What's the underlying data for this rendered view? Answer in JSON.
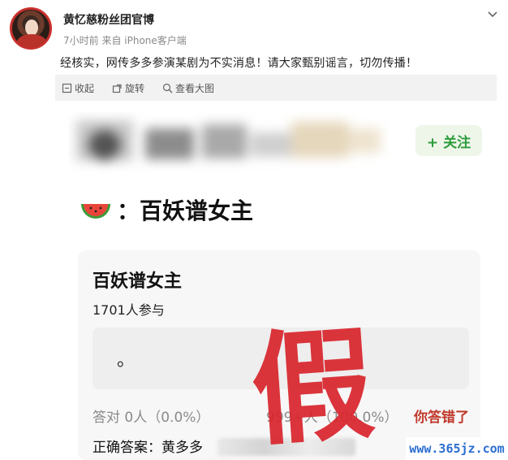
{
  "post": {
    "username": "黄忆慈粉丝团官博",
    "meta": "7小时前  来自 iPhone客户端",
    "text": "经核实，网传多多参演某剧为不实消息！请大家甄别谣言，切勿传播！"
  },
  "image_actions": {
    "collect": "收起",
    "rotate": "旋转",
    "view_large": "查看大图"
  },
  "screenshot": {
    "follow_label": "+ 关注",
    "headline": "：百妖谱女主",
    "poll": {
      "title": "百妖谱女主",
      "participants": "1701人参与",
      "option": "。",
      "correct_label": "答对  0人（0.0%）",
      "result_count": "999+人（100.0%）",
      "wrong_label": "你答错了",
      "answer_label": "正确答案：黄多多"
    },
    "stamp": "假"
  },
  "watermark": "www.365jz.com",
  "colors": {
    "follow_green": "#2c9c3a",
    "stamp_red": "#d9262e",
    "wrong_red": "#c0392b",
    "watermark_blue": "#2d6fd1"
  }
}
